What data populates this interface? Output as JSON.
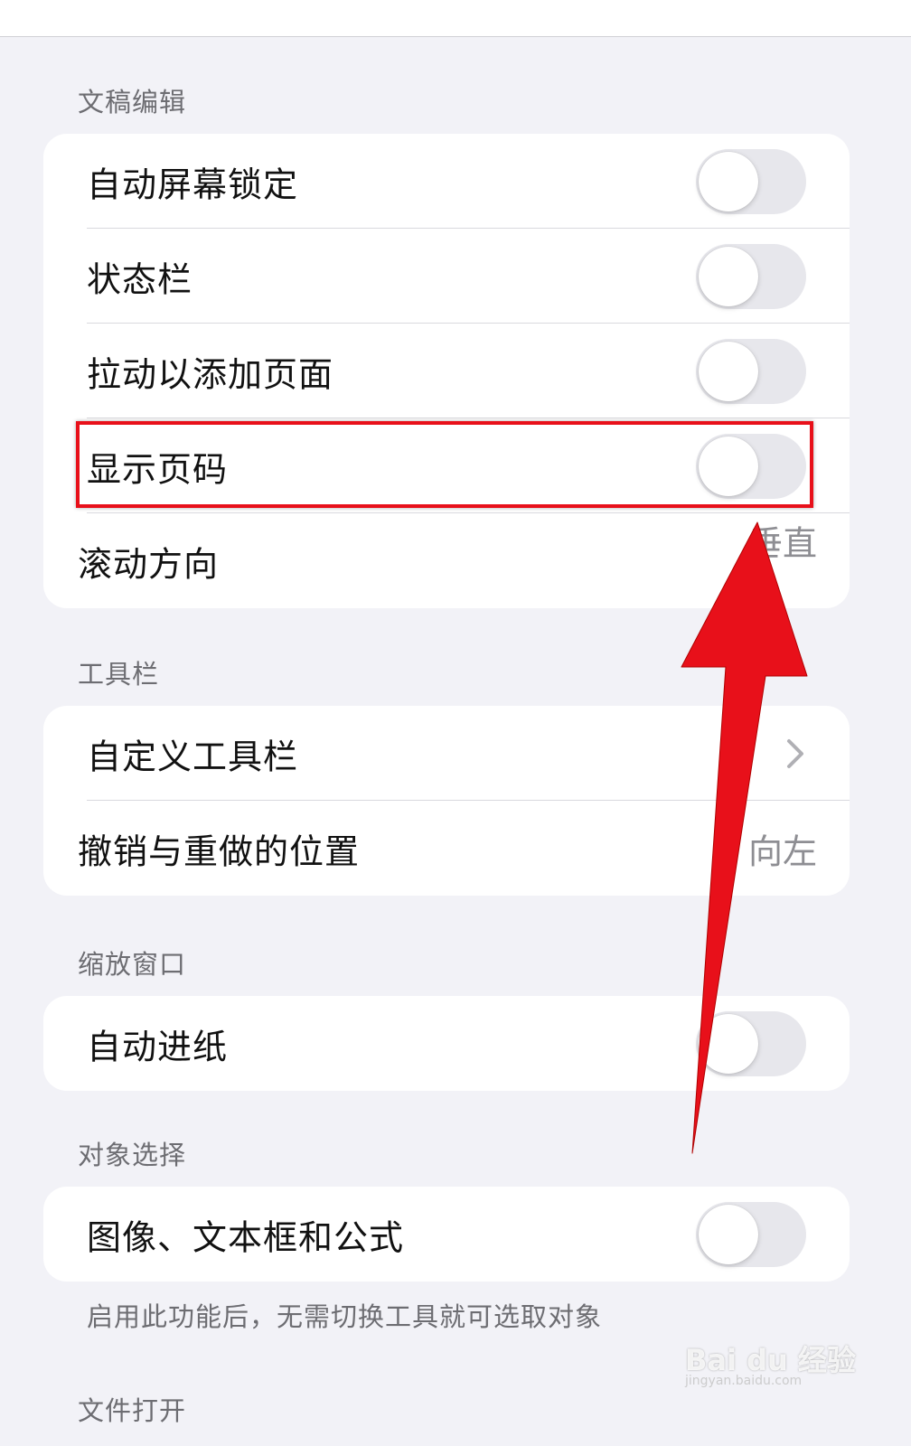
{
  "sections": {
    "manuscript": {
      "header": "文稿编辑",
      "rows": [
        {
          "label": "自动屏幕锁定",
          "toggle": "off"
        },
        {
          "label": "状态栏",
          "toggle": "off"
        },
        {
          "label": "拉动以添加页面",
          "toggle": "off"
        },
        {
          "label": "显示页码",
          "toggle": "off"
        },
        {
          "label": "滚动方向",
          "value": "垂直"
        }
      ]
    },
    "toolbar": {
      "header": "工具栏",
      "rows": [
        {
          "label": "自定义工具栏",
          "icon": "chevron-right-icon"
        },
        {
          "label": "撤销与重做的位置",
          "value": "向左"
        }
      ]
    },
    "zoom_window": {
      "header": "缩放窗口",
      "rows": [
        {
          "label": "自动进纸",
          "toggle": "off"
        }
      ]
    },
    "object_selection": {
      "header": "对象选择",
      "rows": [
        {
          "label": "图像、文本框和公式",
          "toggle": "off"
        }
      ],
      "footer": "启用此功能后，无需切换工具就可选取对象"
    },
    "file_open": {
      "header": "文件打开"
    }
  },
  "annotation": {
    "highlight_color": "#e8101a",
    "arrow_color": "#e8101a",
    "highlight_target": "显示页码"
  },
  "watermark": {
    "main": "Bai du 经验",
    "sub": "jingyan.baidu.com"
  }
}
